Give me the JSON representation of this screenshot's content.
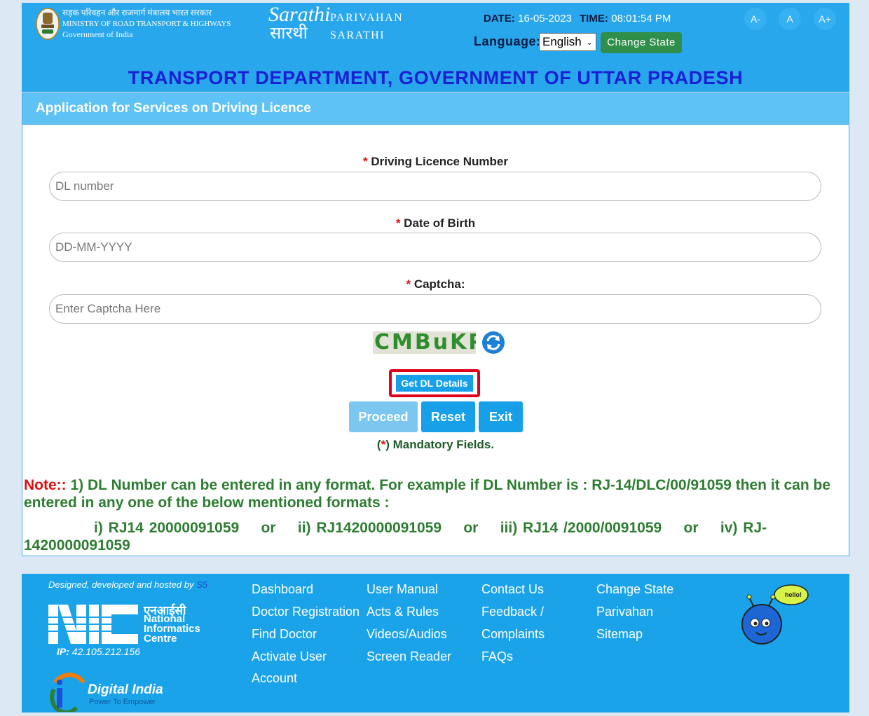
{
  "header": {
    "ministry_hindi": "सड़क परिवहन और राजमार्ग मंत्रालय भारत सरकार",
    "ministry_english": "MINISTRY OF ROAD TRANSPORT & HIGHWAYS",
    "government": "Government of India",
    "brand_line1": "PARIVAHAN",
    "brand_line2": "SARATHI",
    "logo_text": "Sarathi",
    "logo_hindi": "सारथी",
    "date_label": "DATE:",
    "date_value": "16-05-2023",
    "time_label": "TIME:",
    "time_value": "08:01:54 PM",
    "font_decrease": "A-",
    "font_normal": "A",
    "font_increase": "A+",
    "language_label": "Language:",
    "language_selected": "English",
    "change_state_label": "Change State",
    "department_title": "TRANSPORT DEPARTMENT, GOVERNMENT OF UTTAR PRADESH"
  },
  "panel": {
    "title": "Application for Services on Driving Licence",
    "required_mark": "*",
    "dl_label": "Driving Licence Number",
    "dl_placeholder": "DL number",
    "dob_label": "Date of Birth",
    "dob_placeholder": "DD-MM-YYYY",
    "captcha_label": "Captcha:",
    "captcha_placeholder": "Enter Captcha Here",
    "captcha_text": "CMBuKP",
    "get_dl_label": "Get DL Details",
    "proceed_label": "Proceed",
    "reset_label": "Reset",
    "exit_label": "Exit",
    "mandatory_open": "(",
    "mandatory_star": "*",
    "mandatory_text": ") Mandatory Fields."
  },
  "note": {
    "label": "Note::",
    "text": " 1) DL Number can be entered in any format. For example if DL Number is : RJ-14/DLC/00/91059 then it can be entered in any one of the below mentioned formats :",
    "examples": "i) RJ14 20000091059    or    ii) RJ1420000091059    or    iii) RJ14 /2000/0091059    or    iv) RJ-1420000091059"
  },
  "footer": {
    "designed_by": "Designed, developed and hosted by",
    "designed_by_s5": "S5",
    "nic_hindi": "एनआईसी",
    "nic_line1": "National",
    "nic_line2": "Informatics",
    "nic_line3": "Centre",
    "ip_label": "IP:",
    "ip_value": "42.105.212.156",
    "digital_india": "Digital India",
    "digital_india_tagline": "Power To Empower",
    "mascot_text": "hello!",
    "links": {
      "dashboard": "Dashboard",
      "doctor_registration": "Doctor Registration",
      "find_doctor": "Find Doctor",
      "activate_user": "Activate User",
      "account": "Account",
      "user_manual": "User Manual",
      "acts_rules": "Acts & Rules",
      "videos_audios": "Videos/Audios",
      "screen_reader": "Screen Reader",
      "contact_us": "Contact Us",
      "feedback": "Feedback /",
      "complaints": "Complaints",
      "faqs": "FAQs",
      "change_state": "Change State",
      "parivahan": "Parivahan",
      "sitemap": "Sitemap"
    }
  },
  "colors": {
    "header_blue": "#29a7ec",
    "title_blue": "#1a1fd4",
    "green_button": "#2f8e4a",
    "note_green": "#2e7d32",
    "required_red": "#dd1111",
    "highlight_red": "#e0001b"
  }
}
